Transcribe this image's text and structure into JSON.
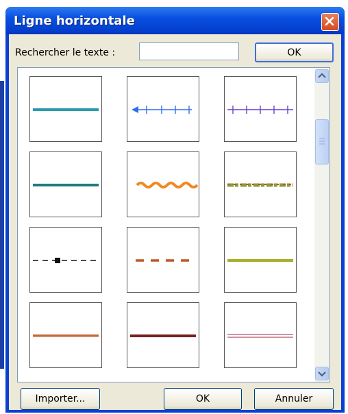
{
  "dialog": {
    "title": "Ligne horizontale",
    "search_label": "Rechercher le texte :",
    "search_value": "",
    "search_ok_label": "OK",
    "import_label": "Importer...",
    "ok_label": "OK",
    "cancel_label": "Annuler"
  },
  "icons": {
    "close": "close-icon",
    "scroll_up": "chevron-up-icon",
    "scroll_down": "chevron-down-icon",
    "scroll_grip": "grip-icon"
  },
  "lines": [
    {
      "style": "solid-thick",
      "color": "#2a9ba8"
    },
    {
      "style": "arrow-ticks",
      "color": "#2f6ff0"
    },
    {
      "style": "ticks",
      "color": "#6a3fc8"
    },
    {
      "style": "solid-thick",
      "color": "#1f7b7f"
    },
    {
      "style": "wave",
      "color": "#f08a20"
    },
    {
      "style": "textured",
      "color": "#8a9a3a"
    },
    {
      "style": "dash-dot",
      "color": "#111111"
    },
    {
      "style": "dashed",
      "color": "#c0562a"
    },
    {
      "style": "solid-thick",
      "color": "#a8b030"
    },
    {
      "style": "solid-double",
      "color": "#c06a3a"
    },
    {
      "style": "solid-thick",
      "color": "#7a1f1f"
    },
    {
      "style": "double-pink",
      "color": "#c07080"
    }
  ]
}
